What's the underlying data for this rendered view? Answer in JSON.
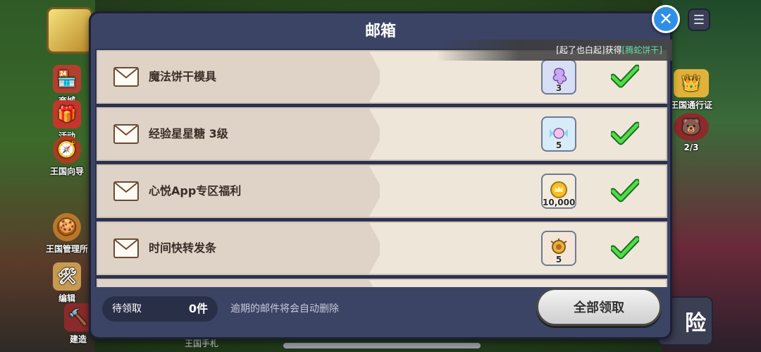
{
  "background": {
    "side_left": [
      {
        "label": "商城",
        "icon": "shop-icon"
      },
      {
        "label": "活动",
        "icon": "gift-icon"
      },
      {
        "label": "王国向导",
        "icon": "compass-icon"
      },
      {
        "label": "王国管理所",
        "icon": "cookie-manager-icon"
      },
      {
        "label": "编辑",
        "icon": "edit-icon"
      },
      {
        "label": "建造",
        "icon": "build-icon"
      }
    ],
    "side_right": [
      {
        "label": "王国通行证",
        "icon": "crown-icon"
      },
      {
        "label": "2/3",
        "icon": "bear-icon"
      }
    ],
    "adventure_label": "险",
    "bottom_hint": "王国手札"
  },
  "mailbox": {
    "title": "邮箱",
    "notice": {
      "user": "[起了也白起]",
      "verb": "获得",
      "item": "[腾蛇饼干]"
    },
    "mails": [
      {
        "title": "魔法饼干模具",
        "reward_icon": "magic-cookie-mold-icon",
        "count": "3"
      },
      {
        "title": "经验星星糖 3级",
        "reward_icon": "star-candy-icon",
        "count": "5"
      },
      {
        "title": "心悦App专区福利",
        "reward_icon": "gold-coin-icon",
        "count": "10,000"
      },
      {
        "title": "时间快转发条",
        "reward_icon": "time-jumper-icon",
        "count": "5"
      },
      {
        "title": "",
        "reward_icon": "",
        "count": ""
      }
    ],
    "pending_label": "待领取",
    "pending_count": "0件",
    "expire_note": "逾期的邮件将会自动删除",
    "claim_all": "全部领取"
  },
  "colors": {
    "panel": "#3c4466",
    "row": "#efe6da",
    "check": "#37c63a",
    "close": "#2f8fe8"
  }
}
